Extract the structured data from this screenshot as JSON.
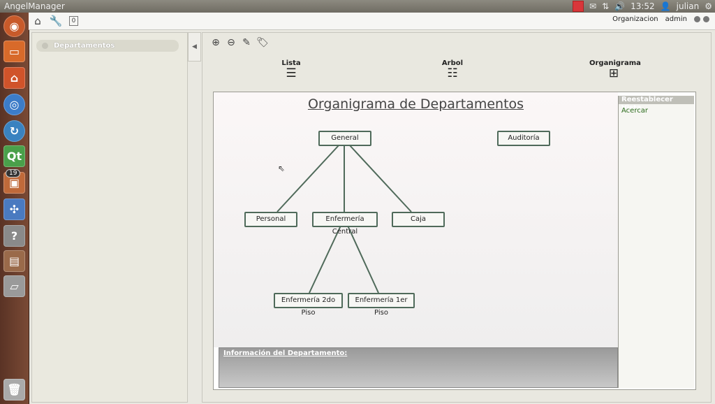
{
  "window": {
    "title": "AngelManager"
  },
  "systray": {
    "time": "13:52",
    "user": "julian"
  },
  "launcher": {
    "badge_count": "19"
  },
  "toolbar": {
    "org_label": "Organizacion",
    "user_label": "admin"
  },
  "left_panel": {
    "items": [
      {
        "label": "Departamentos"
      }
    ]
  },
  "views": {
    "lista": "Lista",
    "arbol": "Arbol",
    "organigrama": "Organigrama"
  },
  "chart": {
    "title": "Organigrama de Departamentos",
    "nodes": {
      "general": "General",
      "auditoria": "Auditoría",
      "personal": "Personal",
      "enfermeria_central": "Enfermería Central",
      "caja": "Caja",
      "enfermeria_2do": "Enfermería 2do Piso",
      "enfermeria_1er": "Enfermería 1er Piso"
    }
  },
  "side_panel": {
    "reset_label": "Reestablecer Vista",
    "zoom_label": "Acercar"
  },
  "info_panel": {
    "title": "Información del Departamento:"
  },
  "colors": {
    "node_border": "#4f6a5a",
    "zoom_link": "#2a6a1a",
    "launcher_bg": "#6a3d2c"
  }
}
